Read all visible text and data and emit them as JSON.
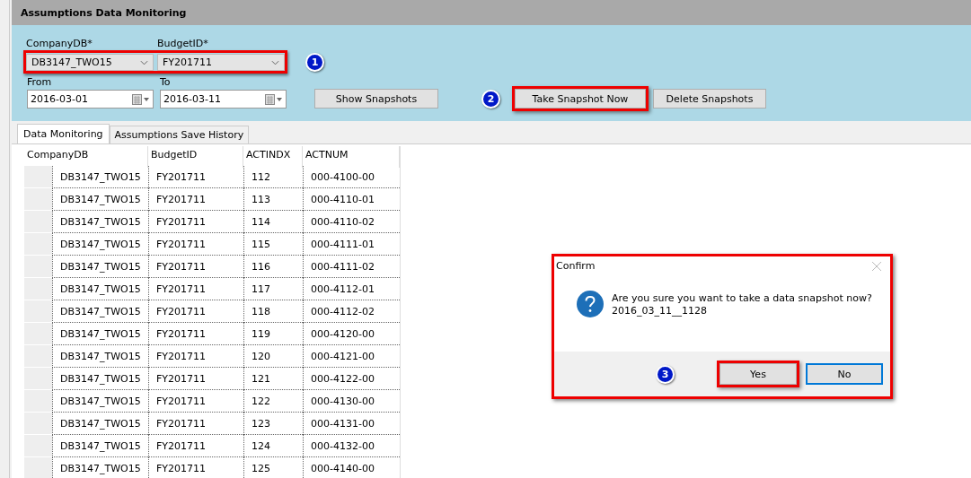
{
  "window": {
    "title": "Assumptions Data Monitoring"
  },
  "selectors": {
    "highlighted": true,
    "callout": "1",
    "fields": [
      {
        "label": "CompanyDB*",
        "value": "DB3147_TWO15"
      },
      {
        "label": "BudgetID*",
        "value": "FY201711"
      }
    ]
  },
  "dates": [
    {
      "label": "From",
      "value": "2016-03-01"
    },
    {
      "label": "To",
      "value": "2016-03-11"
    }
  ],
  "buttons": [
    {
      "label": "Show Snapshots",
      "highlighted": false
    },
    {
      "label": "Take Snapshot Now",
      "highlighted": true,
      "callout": "2"
    },
    {
      "label": "Delete Snapshots",
      "highlighted": false
    }
  ],
  "tabs": [
    {
      "label": "Data Monitoring",
      "selected": true
    },
    {
      "label": "Assumptions Save History",
      "selected": false
    }
  ],
  "table": {
    "columns": [
      "CompanyDB",
      "BudgetID",
      "ACTINDX",
      "ACTNUM"
    ],
    "rows": [
      [
        "DB3147_TWO15",
        "FY201711",
        "112",
        "000-4100-00"
      ],
      [
        "DB3147_TWO15",
        "FY201711",
        "113",
        "000-4110-01"
      ],
      [
        "DB3147_TWO15",
        "FY201711",
        "114",
        "000-4110-02"
      ],
      [
        "DB3147_TWO15",
        "FY201711",
        "115",
        "000-4111-01"
      ],
      [
        "DB3147_TWO15",
        "FY201711",
        "116",
        "000-4111-02"
      ],
      [
        "DB3147_TWO15",
        "FY201711",
        "117",
        "000-4112-01"
      ],
      [
        "DB3147_TWO15",
        "FY201711",
        "118",
        "000-4112-02"
      ],
      [
        "DB3147_TWO15",
        "FY201711",
        "119",
        "000-4120-00"
      ],
      [
        "DB3147_TWO15",
        "FY201711",
        "120",
        "000-4121-00"
      ],
      [
        "DB3147_TWO15",
        "FY201711",
        "121",
        "000-4122-00"
      ],
      [
        "DB3147_TWO15",
        "FY201711",
        "122",
        "000-4130-00"
      ],
      [
        "DB3147_TWO15",
        "FY201711",
        "123",
        "000-4131-00"
      ],
      [
        "DB3147_TWO15",
        "FY201711",
        "124",
        "000-4132-00"
      ],
      [
        "DB3147_TWO15",
        "FY201711",
        "125",
        "000-4140-00"
      ]
    ]
  },
  "dialog": {
    "title": "Confirm",
    "highlighted": true,
    "message": "Are you sure you want to take a data snapshot now?",
    "detail": "2016_03_11__1128",
    "callout": "3",
    "buttons": [
      {
        "label": "Yes",
        "highlighted": true,
        "focused": false
      },
      {
        "label": "No",
        "highlighted": false,
        "focused": true
      }
    ]
  }
}
